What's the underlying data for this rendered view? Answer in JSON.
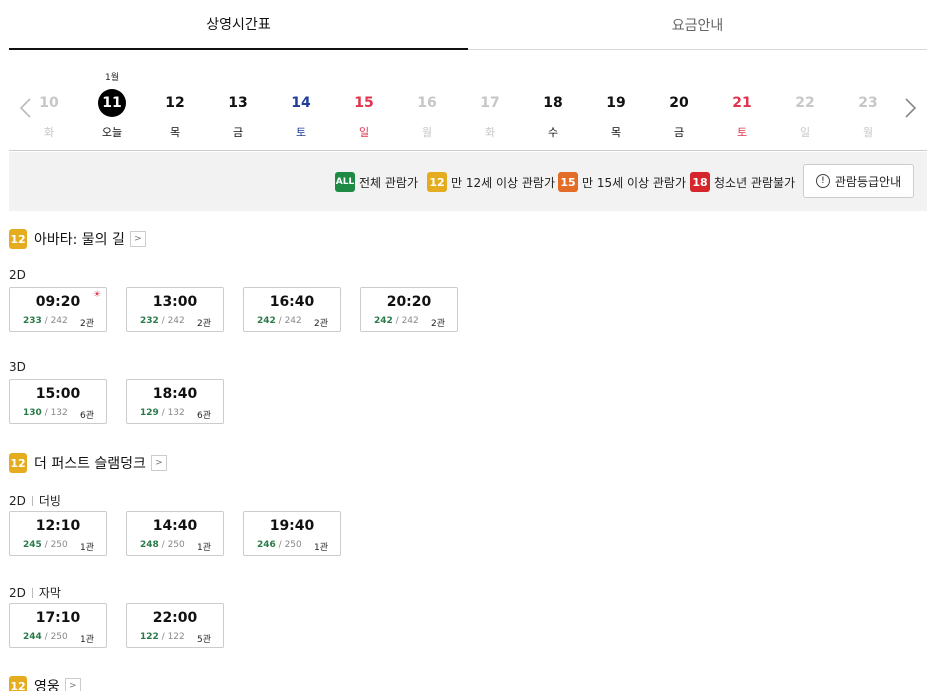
{
  "tabs": [
    {
      "label": "상영시간표",
      "active": true
    },
    {
      "label": "요금안내",
      "active": false
    }
  ],
  "dates": {
    "month_label": "1월",
    "days": [
      {
        "num": "10",
        "dow": "화",
        "type": "dis"
      },
      {
        "num": "11",
        "dow": "오늘",
        "type": "today"
      },
      {
        "num": "12",
        "dow": "목",
        "type": "norm"
      },
      {
        "num": "13",
        "dow": "금",
        "type": "norm"
      },
      {
        "num": "14",
        "dow": "토",
        "type": "sat"
      },
      {
        "num": "15",
        "dow": "일",
        "type": "sun"
      },
      {
        "num": "16",
        "dow": "월",
        "type": "dis"
      },
      {
        "num": "17",
        "dow": "화",
        "type": "dis"
      },
      {
        "num": "18",
        "dow": "수",
        "type": "norm"
      },
      {
        "num": "19",
        "dow": "목",
        "type": "norm"
      },
      {
        "num": "20",
        "dow": "금",
        "type": "norm"
      },
      {
        "num": "21",
        "dow": "토",
        "type": "sun"
      },
      {
        "num": "22",
        "dow": "일",
        "type": "dis"
      },
      {
        "num": "23",
        "dow": "월",
        "type": "dis"
      }
    ],
    "prev_icon": "chevron-left-icon",
    "next_icon": "chevron-right-icon"
  },
  "ratings": {
    "all": {
      "badge": "ALL",
      "label": "전체 관람가"
    },
    "r12": {
      "badge": "12",
      "label": "만 12세 이상 관람가"
    },
    "r15": {
      "badge": "15",
      "label": "만 15세 이상 관람가"
    },
    "r18": {
      "badge": "18",
      "label": "청소년 관람불가"
    },
    "guide_label": "관람등급안내",
    "guide_icon": "!"
  },
  "colors": {
    "green": "#1f8a44",
    "yellow": "#e4ac1e",
    "orange": "#e36c27",
    "red": "#d6262c",
    "sat": "#1f3d99",
    "sun": "#e0344f"
  },
  "movies": [
    {
      "badge": "12",
      "title": "아바타: 물의 길",
      "more": ">",
      "formats": [
        {
          "format": "2D",
          "sub": "",
          "slots": [
            {
              "time": "09:20",
              "avail": "233",
              "total": "242",
              "hall": "2관",
              "mark": "☀"
            },
            {
              "time": "13:00",
              "avail": "232",
              "total": "242",
              "hall": "2관",
              "mark": ""
            },
            {
              "time": "16:40",
              "avail": "242",
              "total": "242",
              "hall": "2관",
              "mark": ""
            },
            {
              "time": "20:20",
              "avail": "242",
              "total": "242",
              "hall": "2관",
              "mark": ""
            }
          ]
        },
        {
          "format": "3D",
          "sub": "",
          "slots": [
            {
              "time": "15:00",
              "avail": "130",
              "total": "132",
              "hall": "6관",
              "mark": ""
            },
            {
              "time": "18:40",
              "avail": "129",
              "total": "132",
              "hall": "6관",
              "mark": ""
            }
          ]
        }
      ]
    },
    {
      "badge": "12",
      "title": "더 퍼스트 슬램덩크",
      "more": ">",
      "formats": [
        {
          "format": "2D",
          "sub": "더빙",
          "slots": [
            {
              "time": "12:10",
              "avail": "245",
              "total": "250",
              "hall": "1관",
              "mark": ""
            },
            {
              "time": "14:40",
              "avail": "248",
              "total": "250",
              "hall": "1관",
              "mark": ""
            },
            {
              "time": "19:40",
              "avail": "246",
              "total": "250",
              "hall": "1관",
              "mark": ""
            }
          ]
        },
        {
          "format": "2D",
          "sub": "자막",
          "slots": [
            {
              "time": "17:10",
              "avail": "244",
              "total": "250",
              "hall": "1관",
              "mark": ""
            },
            {
              "time": "22:00",
              "avail": "122",
              "total": "122",
              "hall": "5관",
              "mark": ""
            }
          ]
        }
      ]
    },
    {
      "badge": "12",
      "title": "영웅",
      "more": ">",
      "formats": []
    }
  ]
}
